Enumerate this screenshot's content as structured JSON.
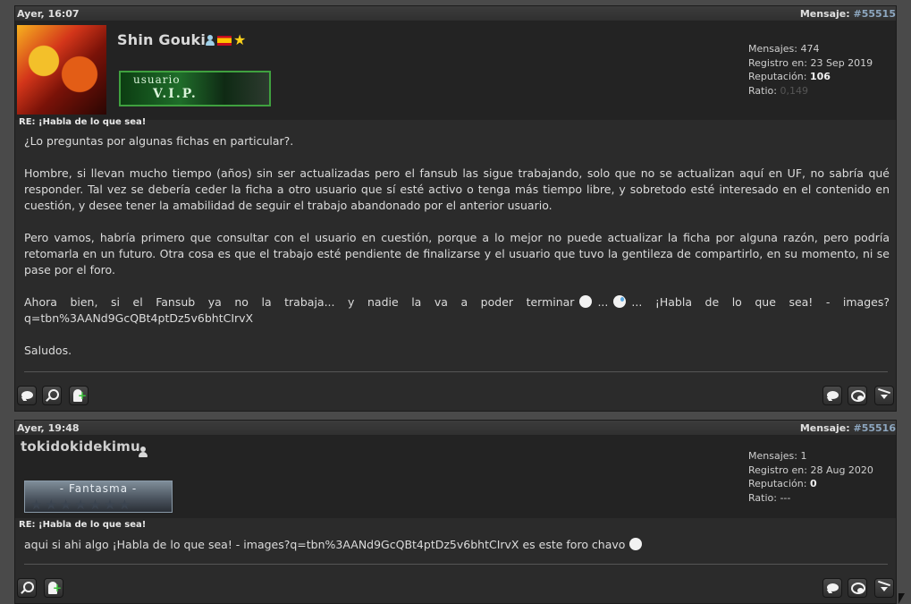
{
  "posts": [
    {
      "time": "Ayer, 16:07",
      "msg_label": "Mensaje:",
      "msg_number": "#55515",
      "username": "Shin Gouki",
      "rank": {
        "line1": "usuario",
        "line2": "V.I.P."
      },
      "stats": {
        "messages_label": "Mensajes:",
        "messages": "474",
        "registered_label": "Registro en:",
        "registered": "23 Sep 2019",
        "reputation_label": "Reputación:",
        "reputation": "106",
        "ratio_label": "Ratio:",
        "ratio": "0,149"
      },
      "re_title": "RE: ¡Habla de lo que sea!",
      "paragraphs": [
        "¿Lo preguntas por algunas fichas en particular?.",
        "Hombre, si llevan mucho tiempo (años) sin ser actualizadas pero el fansub las sigue trabajando, solo que no se actualizan aquí en UF, no sabría qué responder. Tal vez se debería ceder la ficha a otro usuario que sí esté activo o tenga más tiempo libre, y sobretodo esté interesado en el contenido en cuestión, y desee tener la amabilidad de seguir el trabajo abandonado por el anterior usuario.",
        "Pero vamos, habría primero que consultar con el usuario en cuestión, porque a lo mejor no puede actualizar la ficha por alguna razón, pero podría retomarla en un futuro. Otra cosa es que el trabajo esté pendiente de finalizarse y el usuario que tuvo la gentileza de compartirlo, en su momento, ni se pase por el foro."
      ],
      "para4": {
        "part1": "Ahora bien, si el Fansub ya no la trabaja...",
        "part2": "y nadie la va a poder terminar",
        "ellipsis1": "...",
        "ellipsis2": "...",
        "part3": "¡Habla de lo que sea! - images?q=tbn%3AANd9GcQBt4ptDz5v6bhtCIrvX"
      },
      "closing": "Saludos."
    },
    {
      "time": "Ayer, 19:48",
      "msg_label": "Mensaje:",
      "msg_number": "#55516",
      "username": "tokidokidekimu",
      "rank": {
        "line1": "- Fantasma -",
        "line2": "★★★★★★★"
      },
      "stats": {
        "messages_label": "Mensajes:",
        "messages": "1",
        "registered_label": "Registro en:",
        "registered": "28 Aug 2020",
        "reputation_label": "Reputación:",
        "reputation": "0",
        "ratio_label": "Ratio:",
        "ratio": "---"
      },
      "re_title": "RE: ¡Habla de lo que sea!",
      "text": "aqui si ahi algo ¡Habla de lo que sea! - images?q=tbn%3AANd9GcQBt4ptDz5v6bhtCIrvX es este foro chavo"
    }
  ],
  "icons": [
    "quote-bubble-icon",
    "search-icon",
    "add-user-icon",
    "reply-icon",
    "quote-icon",
    "report-icon",
    "user-icon",
    "flag-es-icon",
    "star-icon",
    "smiley-icon"
  ]
}
